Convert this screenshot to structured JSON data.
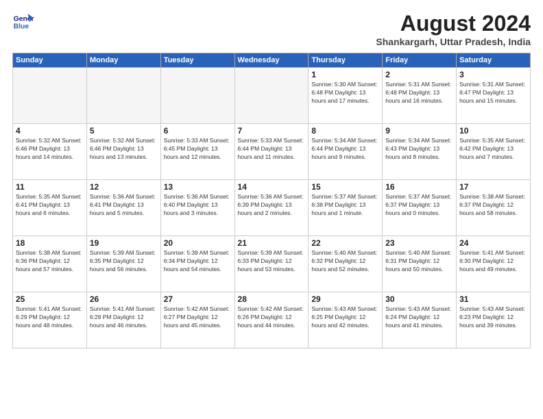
{
  "logo": {
    "line1": "General",
    "line2": "Blue"
  },
  "title": "August 2024",
  "subtitle": "Shankargarh, Uttar Pradesh, India",
  "weekdays": [
    "Sunday",
    "Monday",
    "Tuesday",
    "Wednesday",
    "Thursday",
    "Friday",
    "Saturday"
  ],
  "weeks": [
    [
      {
        "day": "",
        "info": ""
      },
      {
        "day": "",
        "info": ""
      },
      {
        "day": "",
        "info": ""
      },
      {
        "day": "",
        "info": ""
      },
      {
        "day": "1",
        "info": "Sunrise: 5:30 AM\nSunset: 6:48 PM\nDaylight: 13 hours\nand 17 minutes."
      },
      {
        "day": "2",
        "info": "Sunrise: 5:31 AM\nSunset: 6:48 PM\nDaylight: 13 hours\nand 16 minutes."
      },
      {
        "day": "3",
        "info": "Sunrise: 5:31 AM\nSunset: 6:47 PM\nDaylight: 13 hours\nand 15 minutes."
      }
    ],
    [
      {
        "day": "4",
        "info": "Sunrise: 5:32 AM\nSunset: 6:46 PM\nDaylight: 13 hours\nand 14 minutes."
      },
      {
        "day": "5",
        "info": "Sunrise: 5:32 AM\nSunset: 6:46 PM\nDaylight: 13 hours\nand 13 minutes."
      },
      {
        "day": "6",
        "info": "Sunrise: 5:33 AM\nSunset: 6:45 PM\nDaylight: 13 hours\nand 12 minutes."
      },
      {
        "day": "7",
        "info": "Sunrise: 5:33 AM\nSunset: 6:44 PM\nDaylight: 13 hours\nand 11 minutes."
      },
      {
        "day": "8",
        "info": "Sunrise: 5:34 AM\nSunset: 6:44 PM\nDaylight: 13 hours\nand 9 minutes."
      },
      {
        "day": "9",
        "info": "Sunrise: 5:34 AM\nSunset: 6:43 PM\nDaylight: 13 hours\nand 8 minutes."
      },
      {
        "day": "10",
        "info": "Sunrise: 5:35 AM\nSunset: 6:42 PM\nDaylight: 13 hours\nand 7 minutes."
      }
    ],
    [
      {
        "day": "11",
        "info": "Sunrise: 5:35 AM\nSunset: 6:41 PM\nDaylight: 13 hours\nand 6 minutes."
      },
      {
        "day": "12",
        "info": "Sunrise: 5:36 AM\nSunset: 6:41 PM\nDaylight: 13 hours\nand 5 minutes."
      },
      {
        "day": "13",
        "info": "Sunrise: 5:36 AM\nSunset: 6:40 PM\nDaylight: 13 hours\nand 3 minutes."
      },
      {
        "day": "14",
        "info": "Sunrise: 5:36 AM\nSunset: 6:39 PM\nDaylight: 13 hours\nand 2 minutes."
      },
      {
        "day": "15",
        "info": "Sunrise: 5:37 AM\nSunset: 6:38 PM\nDaylight: 13 hours\nand 1 minute."
      },
      {
        "day": "16",
        "info": "Sunrise: 5:37 AM\nSunset: 6:37 PM\nDaylight: 13 hours\nand 0 minutes."
      },
      {
        "day": "17",
        "info": "Sunrise: 5:38 AM\nSunset: 6:37 PM\nDaylight: 12 hours\nand 58 minutes."
      }
    ],
    [
      {
        "day": "18",
        "info": "Sunrise: 5:38 AM\nSunset: 6:36 PM\nDaylight: 12 hours\nand 57 minutes."
      },
      {
        "day": "19",
        "info": "Sunrise: 5:39 AM\nSunset: 6:35 PM\nDaylight: 12 hours\nand 56 minutes."
      },
      {
        "day": "20",
        "info": "Sunrise: 5:39 AM\nSunset: 6:34 PM\nDaylight: 12 hours\nand 54 minutes."
      },
      {
        "day": "21",
        "info": "Sunrise: 5:39 AM\nSunset: 6:33 PM\nDaylight: 12 hours\nand 53 minutes."
      },
      {
        "day": "22",
        "info": "Sunrise: 5:40 AM\nSunset: 6:32 PM\nDaylight: 12 hours\nand 52 minutes."
      },
      {
        "day": "23",
        "info": "Sunrise: 5:40 AM\nSunset: 6:31 PM\nDaylight: 12 hours\nand 50 minutes."
      },
      {
        "day": "24",
        "info": "Sunrise: 5:41 AM\nSunset: 6:30 PM\nDaylight: 12 hours\nand 49 minutes."
      }
    ],
    [
      {
        "day": "25",
        "info": "Sunrise: 5:41 AM\nSunset: 6:29 PM\nDaylight: 12 hours\nand 48 minutes."
      },
      {
        "day": "26",
        "info": "Sunrise: 5:41 AM\nSunset: 6:28 PM\nDaylight: 12 hours\nand 46 minutes."
      },
      {
        "day": "27",
        "info": "Sunrise: 5:42 AM\nSunset: 6:27 PM\nDaylight: 12 hours\nand 45 minutes."
      },
      {
        "day": "28",
        "info": "Sunrise: 5:42 AM\nSunset: 6:26 PM\nDaylight: 12 hours\nand 44 minutes."
      },
      {
        "day": "29",
        "info": "Sunrise: 5:43 AM\nSunset: 6:25 PM\nDaylight: 12 hours\nand 42 minutes."
      },
      {
        "day": "30",
        "info": "Sunrise: 5:43 AM\nSunset: 6:24 PM\nDaylight: 12 hours\nand 41 minutes."
      },
      {
        "day": "31",
        "info": "Sunrise: 5:43 AM\nSunset: 6:23 PM\nDaylight: 12 hours\nand 39 minutes."
      }
    ]
  ]
}
